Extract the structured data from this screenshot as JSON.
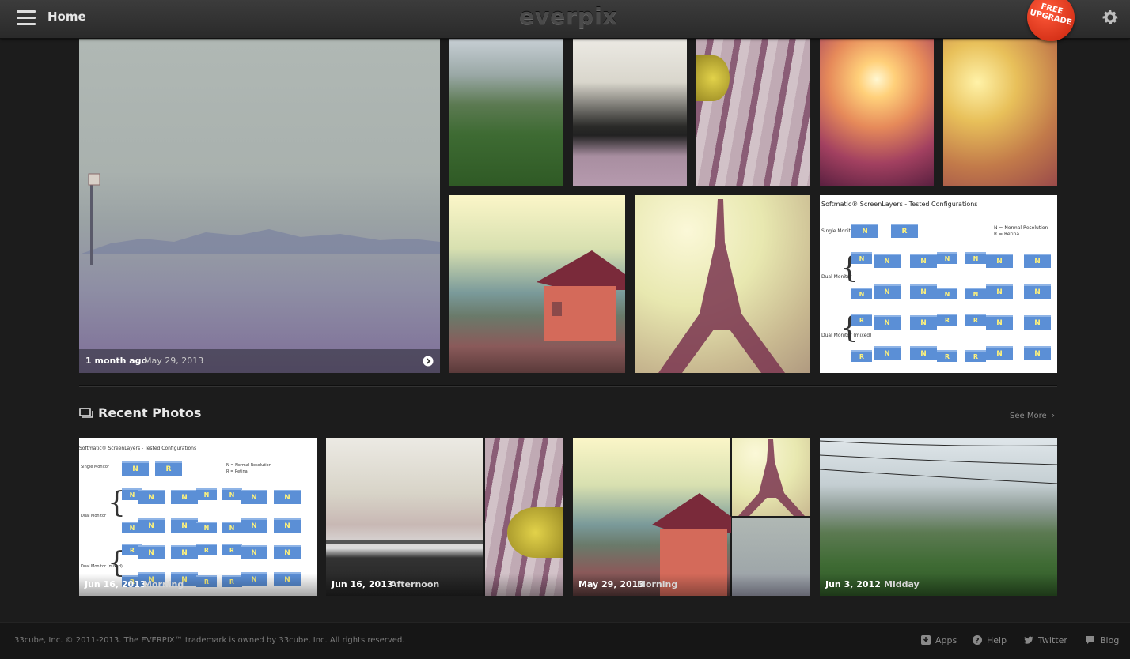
{
  "header": {
    "home_label": "Home",
    "logo_text": "everpix",
    "upgrade_line1": "FREE",
    "upgrade_line2": "UPGRADE",
    "upgrade_color": "#e2401f"
  },
  "hero": {
    "relative_time": "1 month ago",
    "date": "May 29, 2013"
  },
  "diagram": {
    "title": "Softmatic® ScreenLayers - Tested Configurations",
    "legend_n": "N  =  Normal Resolution",
    "legend_r": "R  =  Retina",
    "single_label": "Single Monitor",
    "dual_label": "Dual Monitor",
    "dual_mixed_label": "Dual Monitor (mixed)"
  },
  "recent": {
    "title": "Recent Photos",
    "see_more": "See More",
    "cards": [
      {
        "date": "Jun 16, 2013",
        "part": "Morning"
      },
      {
        "date": "Jun 16, 2013",
        "part": "Afternoon"
      },
      {
        "date": "May 29, 2013",
        "part": "Morning"
      },
      {
        "date": "Jun 3, 2012",
        "part": "Midday"
      }
    ]
  },
  "footer": {
    "copyright": "33cube, Inc. © 2011-2013. The EVERPIX™ trademark is owned by 33cube, Inc. All rights reserved.",
    "links": {
      "apps": "Apps",
      "help": "Help",
      "twitter": "Twitter",
      "blog": "Blog"
    }
  }
}
